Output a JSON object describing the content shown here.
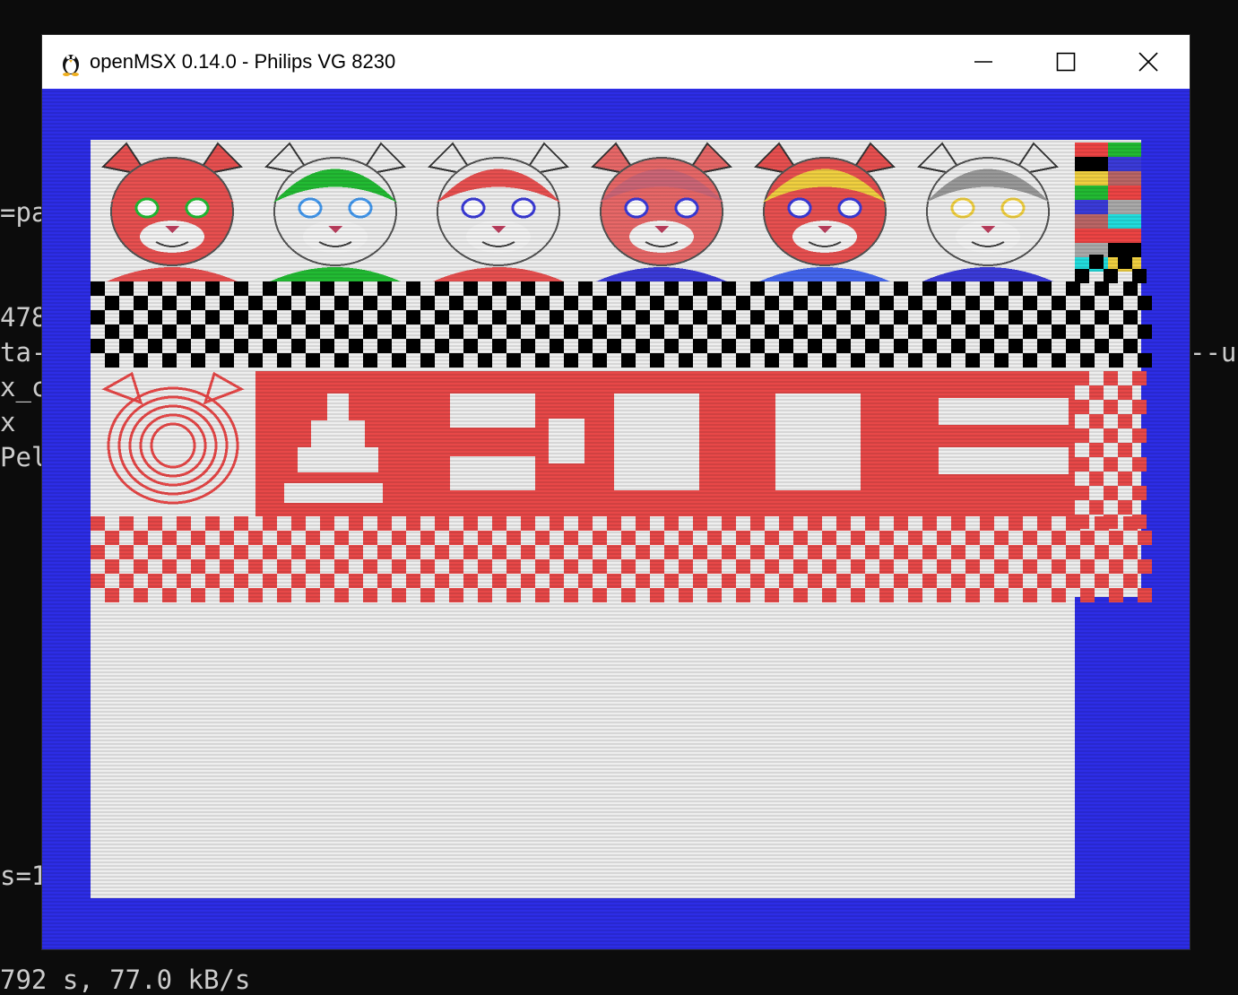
{
  "terminal": {
    "lines": [
      "=pa",
      "478",
      "ta-",
      "x_c",
      "x",
      "Pel",
      "s=1",
      "--us",
      "792 s, 77.0 kB/s"
    ]
  },
  "window": {
    "title": "openMSX 0.14.0 - Philips VG 8230",
    "app_icon": "penguin-icon",
    "controls": {
      "minimize": "minimize-icon",
      "maximize": "maximize-icon",
      "close": "close-icon"
    }
  },
  "emulator": {
    "border_color": "#2d2de6",
    "background_color": "#eeeeee",
    "accent_red": "#e84848",
    "palette_swatches": [
      "#ee4444",
      "#000000",
      "#f0d040",
      "#22bb33",
      "#3b3bd9",
      "#bb6666",
      "#ee4444",
      "#aaaaaa",
      "#22dddd"
    ],
    "portraits": [
      {
        "name": "red-fox-portrait",
        "fur": "#e85050",
        "hair": "#e85050",
        "accent": "#22bb33",
        "clothes": "#e85050"
      },
      {
        "name": "green-cap-cat-portrait",
        "fur": "#eeeeee",
        "hair": "#22bb33",
        "accent": "#4499ee",
        "clothes": "#22bb33"
      },
      {
        "name": "red-hair-cat-portrait",
        "fur": "#eeeeee",
        "hair": "#e85050",
        "accent": "#3b3bd9",
        "clothes": "#e85050"
      },
      {
        "name": "pink-cat-portrait",
        "fur": "#e86868",
        "hair": "#cc6677",
        "accent": "#3b3bd9",
        "clothes": "#3b3bd9"
      },
      {
        "name": "blonde-cat-portrait",
        "fur": "#e85050",
        "hair": "#f0d040",
        "accent": "#3b3bd9",
        "clothes": "#4466ee"
      },
      {
        "name": "grey-hair-cat-portrait",
        "fur": "#eeeeee",
        "hair": "#999999",
        "accent": "#f0d040",
        "clothes": "#3b3bd9"
      }
    ]
  }
}
